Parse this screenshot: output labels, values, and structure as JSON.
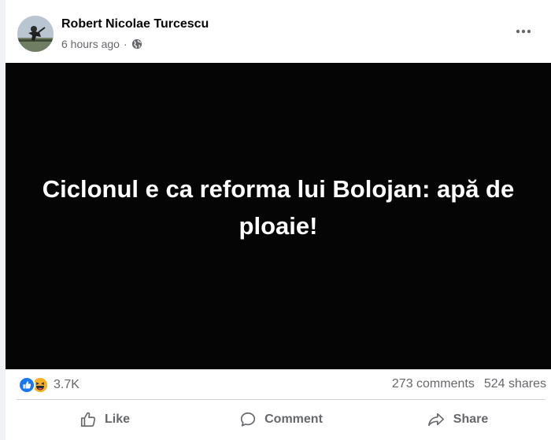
{
  "post": {
    "author": "Robert Nicolae Turcescu",
    "time": "6 hours ago",
    "separator": "·",
    "audience_icon": "globe-icon",
    "menu_icon": "more-options-icon",
    "media_text": "Ciclonul e ca reforma lui Bolojan: apă de ploaie!"
  },
  "stats": {
    "reaction_icons": [
      "like-reaction-icon",
      "haha-reaction-icon"
    ],
    "reactions_count": "3.7K",
    "comments": "273 comments",
    "shares": "524 shares"
  },
  "actions": {
    "like": "Like",
    "comment": "Comment",
    "share": "Share"
  },
  "colors": {
    "like_blue": "#1877f2",
    "haha_yellow": "#f7b125",
    "secondary_text": "#65676b",
    "media_background": "#050505"
  }
}
